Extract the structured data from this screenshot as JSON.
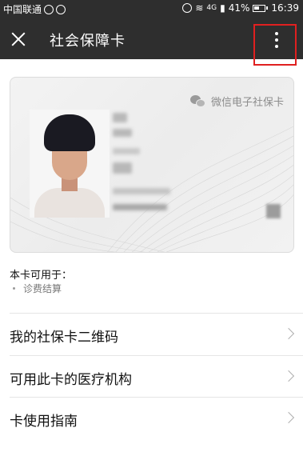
{
  "status_bar": {
    "carrier": "中国联通",
    "network": "4G",
    "battery": "41%",
    "time": "16:39"
  },
  "header": {
    "title": "社会保障卡",
    "close_icon": "close-icon",
    "more_icon": "more-vertical-icon",
    "highlight_color": "#e02020"
  },
  "card": {
    "brand": "微信电子社保卡",
    "brand_icon": "wechat-icon"
  },
  "usage": {
    "title": "本卡可用于：",
    "items": [
      "诊费结算"
    ]
  },
  "menu": {
    "items": [
      {
        "label": "我的社保卡二维码"
      },
      {
        "label": "可用此卡的医疗机构"
      },
      {
        "label": "卡使用指南"
      }
    ]
  }
}
